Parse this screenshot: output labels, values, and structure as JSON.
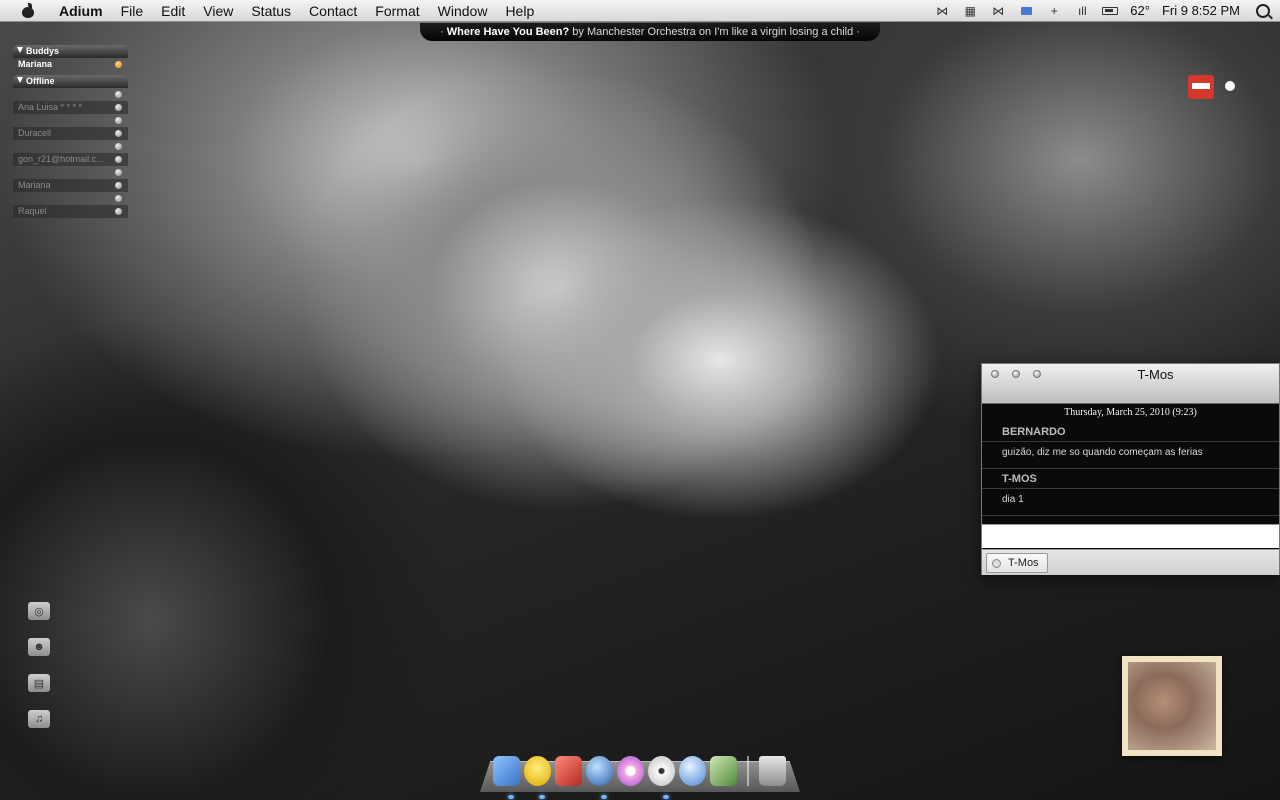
{
  "menubar": {
    "app_name": "Adium",
    "items": [
      "File",
      "Edit",
      "View",
      "Status",
      "Contact",
      "Format",
      "Window",
      "Help"
    ],
    "temperature": "62°",
    "clock": "Fri 9  8:52 PM",
    "status_icons": [
      "bowtie-icon",
      "grid-icon",
      "bowtie-icon",
      "mail-icon",
      "plus-icon",
      "signal-icon",
      "battery-icon"
    ]
  },
  "now_playing": {
    "song": "Where Have You Been?",
    "by_text": "by",
    "artist": "Manchester Orchestra",
    "on_text": "on",
    "album": "I'm like a virgin losing a child",
    "bullet": "·"
  },
  "contact_list": {
    "groups": [
      {
        "name": "Buddys",
        "contacts": [
          {
            "name": "Mariana",
            "status": "online"
          }
        ]
      },
      {
        "name": "Offline",
        "contacts": [
          {
            "name": "Ana Luisa * * * *",
            "status": "offline"
          },
          {
            "name": "Duracell",
            "status": "offline"
          },
          {
            "name": "gon_r21@hotmail.c...",
            "status": "offline"
          },
          {
            "name": "Mariana",
            "status": "offline"
          },
          {
            "name": "Raquel",
            "status": "offline"
          }
        ]
      }
    ]
  },
  "side_icons": [
    "drive-icon",
    "home-folder-icon",
    "documents-icon",
    "music-icon"
  ],
  "chat": {
    "title": "T-Mos",
    "date": "Thursday, March 25, 2010 (9:23)",
    "messages": [
      {
        "sender": "BERNARDO",
        "text": "guizão, diz me so quando começam as ferias"
      },
      {
        "sender": "T-MOS",
        "text": "dia 1"
      }
    ],
    "input_value": "",
    "tab_label": "T-Mos"
  },
  "dock": {
    "items": [
      "finder-icon",
      "adium-duck-icon",
      "photo-booth-icon",
      "network-globe-icon",
      "itunes-icon",
      "dvd-icon",
      "safari-icon",
      "iphoto-icon",
      "trash-icon"
    ],
    "colors": [
      "#4a90e2",
      "#f5c518",
      "#d9443a",
      "#3b74c4",
      "#e77fd5",
      "#eeeeee",
      "#6aa0e8",
      "#7fae5a",
      "#b9b9b9"
    ]
  },
  "colors": {
    "online_status": "#e48a12",
    "dock_indicator": "#6fb6ff"
  }
}
